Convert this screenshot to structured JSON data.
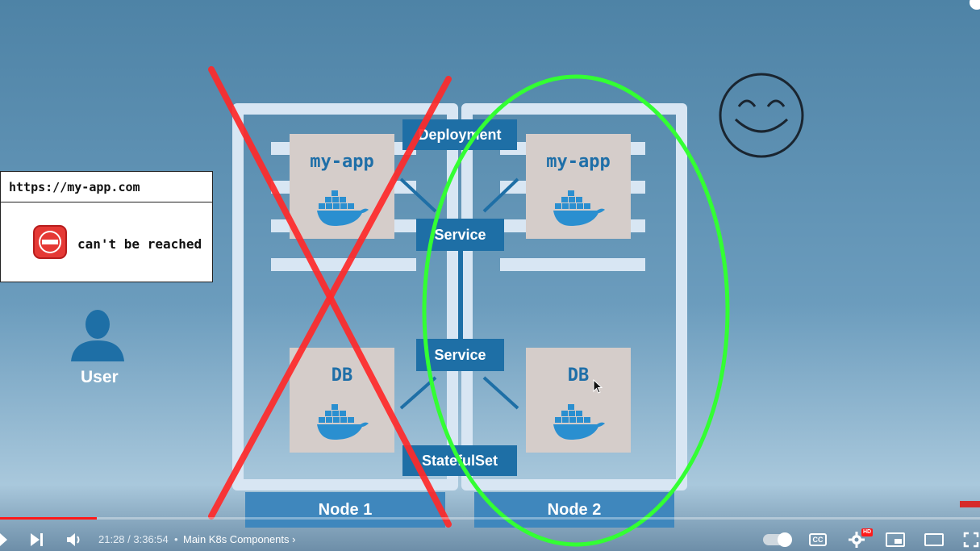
{
  "popup": {
    "url": "https://my-app.com",
    "message": "can't be reached"
  },
  "user": {
    "label": "User"
  },
  "diagram": {
    "deployment_label": "Deployment",
    "statefulset_label": "StatefulSet",
    "service_top_label": "Service",
    "service_bottom_label": "Service",
    "node1": {
      "label": "Node 1",
      "app_pod": "my-app",
      "db_pod": "DB"
    },
    "node2": {
      "label": "Node 2",
      "app_pod": "my-app",
      "db_pod": "DB"
    }
  },
  "player": {
    "time": "21:28 / 3:36:54",
    "separator": "•",
    "chapter": "Main K8s Components",
    "progress_fraction": 0.0989,
    "hd_badge": "HD",
    "cc_label": "CC",
    "accent_color": "#ff1a1a"
  },
  "colors": {
    "cross": "#ff2a2a",
    "ellipse": "#33ff33",
    "k8s_blue": "#1e6fa6"
  }
}
